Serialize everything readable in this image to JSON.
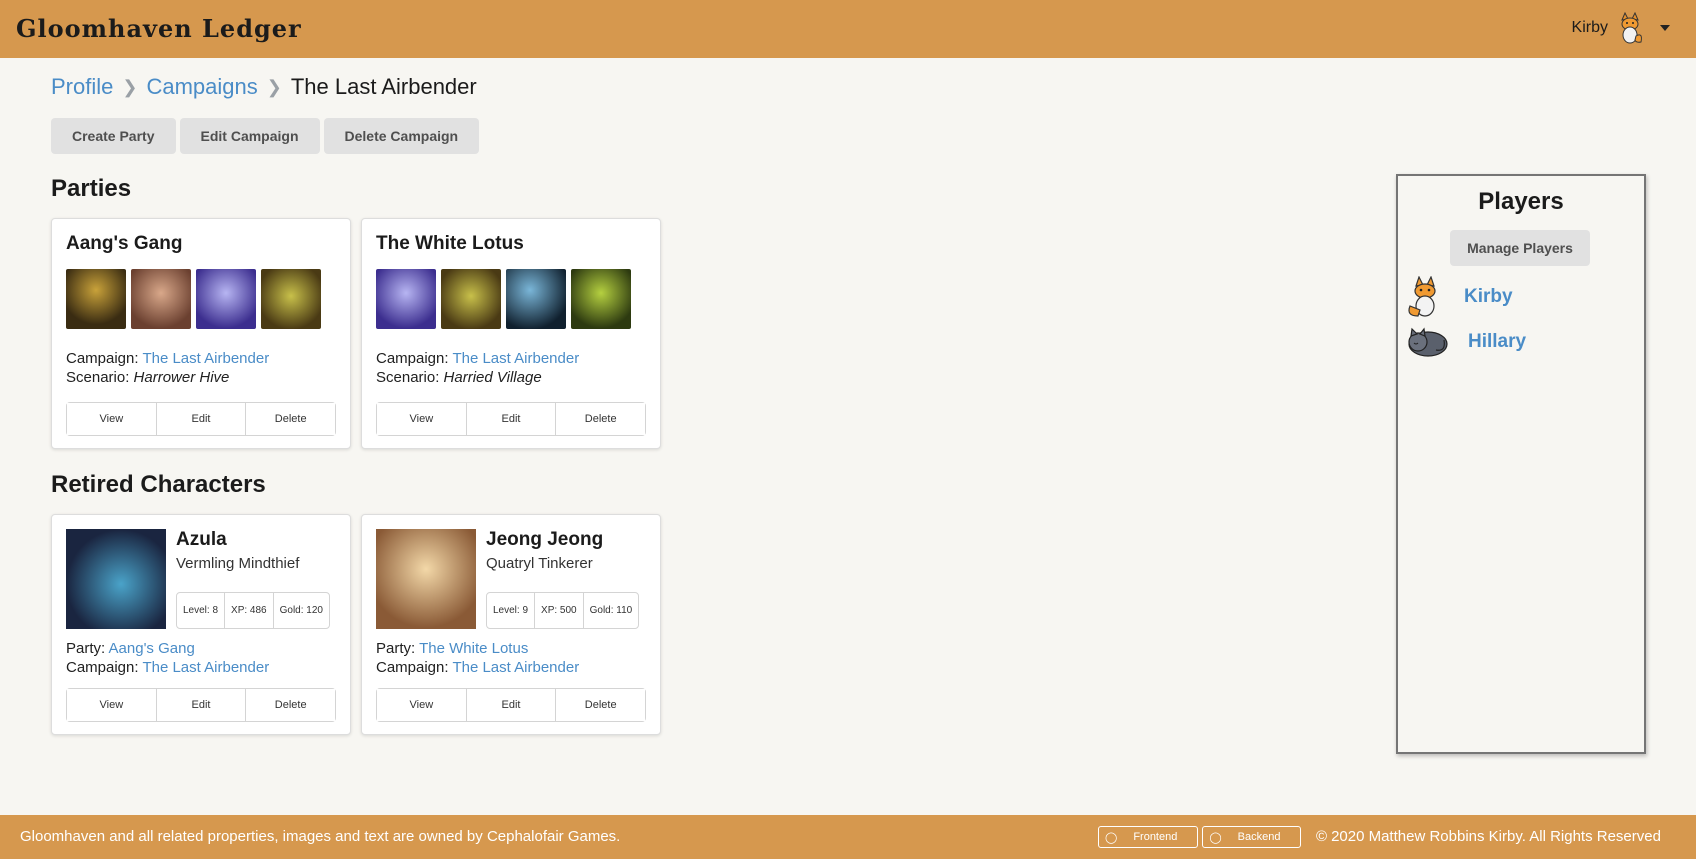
{
  "header": {
    "brand": "Gloomhaven Ledger",
    "user_name": "Kirby"
  },
  "breadcrumb": {
    "items": [
      "Profile",
      "Campaigns"
    ],
    "current": "The Last Airbender"
  },
  "actions": {
    "create_party": "Create Party",
    "edit_campaign": "Edit Campaign",
    "delete_campaign": "Delete Campaign"
  },
  "parties": {
    "heading": "Parties",
    "cards": [
      {
        "name": "Aang's Gang",
        "campaign_label": "Campaign:",
        "campaign": "The Last Airbender",
        "scenario_label": "Scenario:",
        "scenario": "Harrower Hive"
      },
      {
        "name": "The White Lotus",
        "campaign_label": "Campaign:",
        "campaign": "The Last Airbender",
        "scenario_label": "Scenario:",
        "scenario": "Harried Village"
      }
    ]
  },
  "card_buttons": {
    "view": "View",
    "edit": "Edit",
    "delete": "Delete"
  },
  "retired": {
    "heading": "Retired Characters",
    "cards": [
      {
        "name": "Azula",
        "class": "Vermling Mindthief",
        "level": "Level: 8",
        "xp": "XP: 486",
        "gold": "Gold: 120",
        "party_label": "Party:",
        "party": "Aang's Gang",
        "campaign_label": "Campaign:",
        "campaign": "The Last Airbender"
      },
      {
        "name": "Jeong Jeong",
        "class": "Quatryl Tinkerer",
        "level": "Level: 9",
        "xp": "XP: 500",
        "gold": "Gold: 110",
        "party_label": "Party:",
        "party": "The White Lotus",
        "campaign_label": "Campaign:",
        "campaign": "The Last Airbender"
      }
    ]
  },
  "players": {
    "heading": "Players",
    "manage": "Manage Players",
    "list": [
      "Kirby",
      "Hillary"
    ]
  },
  "footer": {
    "owned": "Gloomhaven and all related properties, images and text are owned by Cephalofair Games.",
    "frontend": "Frontend",
    "backend": "Backend",
    "copyright": "2020 Matthew Robbins Kirby. All Rights Reserved"
  },
  "colors": {
    "header_bg": "#d6984e",
    "link": "#4a8cc7",
    "page_bg": "#f7f6f2"
  }
}
